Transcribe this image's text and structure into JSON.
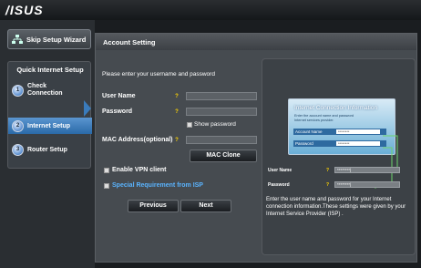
{
  "logo": "/ISUS",
  "sidebar": {
    "skip_label": "Skip Setup Wizard",
    "qis_title": "Quick Internet Setup",
    "steps": [
      {
        "num": "1",
        "label": "Check Connection"
      },
      {
        "num": "2",
        "label": "Internet Setup"
      },
      {
        "num": "3",
        "label": "Router Setup"
      }
    ]
  },
  "main": {
    "header": "Account Setting",
    "intro": "Please enter your username and password",
    "username_label": "User Name",
    "password_label": "Password",
    "help_glyph": "?",
    "show_password": "Show password",
    "mac_label": "MAC Address(optional)",
    "mac_clone": "MAC Clone",
    "vpn_label": "Enable VPN client",
    "special_label": "Special Requirement from ISP",
    "previous": "Previous",
    "next": "Next"
  },
  "info": {
    "title": "Internet Connection Information",
    "text1": "Enter the account name and password",
    "text2": "Internet services provider.",
    "account_label": "Account Name",
    "account_mask": "********",
    "password_label": "Password",
    "password_mask": "********",
    "user_label": "User Name",
    "user_mask": "********|",
    "pw_label": "Password",
    "pw_mask": "********|",
    "description": "Enter the user name and password for your Internet connection information.These settings were given by your Internet Service Provider (ISP) ."
  },
  "colors": {
    "accent": "#2a6aa8",
    "help": "#ffd400",
    "link": "#5ab4ff"
  }
}
